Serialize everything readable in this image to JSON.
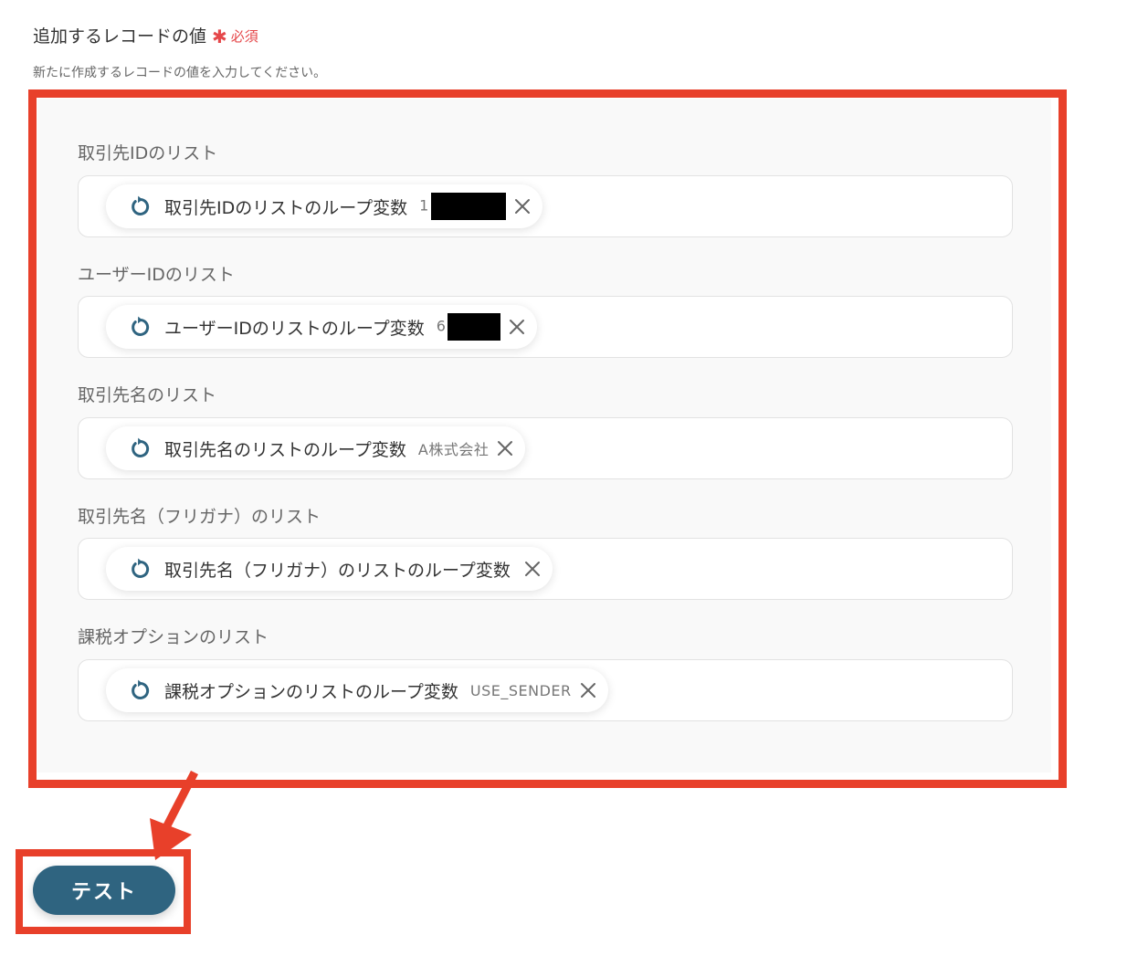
{
  "header": {
    "title": "追加するレコードの値",
    "required_mark": "✱",
    "required_text": "必須",
    "description": "新たに作成するレコードの値を入力してください。"
  },
  "fields": [
    {
      "label": "取引先IDのリスト",
      "chip_label": "取引先IDのリストのループ変数",
      "chip_value": "1",
      "redacted": true
    },
    {
      "label": "ユーザーIDのリスト",
      "chip_label": "ユーザーIDのリストのループ変数",
      "chip_value": "6",
      "redacted": true
    },
    {
      "label": "取引先名のリスト",
      "chip_label": "取引先名のリストのループ変数",
      "chip_value": "A株式会社",
      "redacted": false
    },
    {
      "label": "取引先名（フリガナ）のリスト",
      "chip_label": "取引先名（フリガナ）のリストのループ変数",
      "chip_value": "",
      "redacted": false
    },
    {
      "label": "課税オプションのリスト",
      "chip_label": "課税オプションのリストのループ変数",
      "chip_value": "USE_SENDER",
      "redacted": false
    }
  ],
  "actions": {
    "test_label": "テスト"
  },
  "colors": {
    "accent": "#2f6480",
    "required": "#e5474a",
    "highlight": "#e8402a",
    "icon": "#2f6480"
  },
  "icons": {
    "chip_icon": "loop-refresh-icon",
    "remove_icon": "close-icon"
  }
}
